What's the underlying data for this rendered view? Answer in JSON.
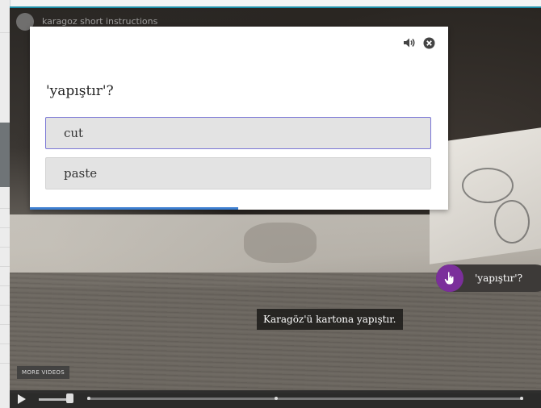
{
  "player": {
    "title": "karagoz short instructions",
    "more_videos": "MORE VIDEOS",
    "subtitle": "Karagöz'ü kartona yapıştır.",
    "hotspot_label": "'yapıştır'?"
  },
  "modal": {
    "question": "'yapıştır'?",
    "options": [
      {
        "label": "cut"
      },
      {
        "label": "paste"
      }
    ],
    "icons": [
      "speaker-icon",
      "close-icon"
    ]
  },
  "colors": {
    "accent": "#7b2f9b",
    "progress": "#3d7fd1",
    "selected_border": "#7a76d6",
    "player_border": "#1e8fa8"
  }
}
